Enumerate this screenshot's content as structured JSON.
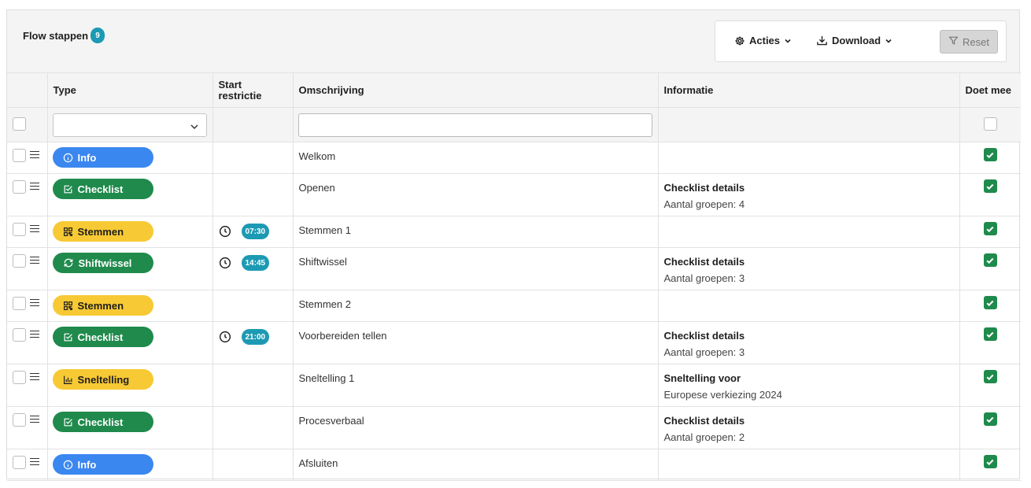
{
  "header": {
    "title": "Flow stappen",
    "count": "9"
  },
  "toolbar": {
    "acties_label": "Acties",
    "download_label": "Download",
    "reset_label": "Reset"
  },
  "columns": {
    "type": "Type",
    "start_line1": "Start",
    "start_line2": "restrictie",
    "omschrijving": "Omschrijving",
    "informatie": "Informatie",
    "doet_mee": "Doet mee"
  },
  "filters": {
    "type_value": "",
    "omschrijving_value": ""
  },
  "colors": {
    "info": "#3b87f0",
    "green": "#1f8a4c",
    "yellow": "#f7c934",
    "teal": "#1c9ab3"
  },
  "rows": [
    {
      "type": "Info",
      "kind": "info",
      "time": "",
      "omschrijving": "Welkom",
      "info_title": "",
      "info_sub": "",
      "doet_mee": true
    },
    {
      "type": "Checklist",
      "kind": "checklist",
      "time": "",
      "omschrijving": "Openen",
      "info_title": "Checklist details",
      "info_sub": "Aantal groepen: 4",
      "doet_mee": true
    },
    {
      "type": "Stemmen",
      "kind": "stemmen",
      "time": "07:30",
      "omschrijving": "Stemmen 1",
      "info_title": "",
      "info_sub": "",
      "doet_mee": true
    },
    {
      "type": "Shiftwissel",
      "kind": "shiftwissel",
      "time": "14:45",
      "omschrijving": "Shiftwissel",
      "info_title": "Checklist details",
      "info_sub": "Aantal groepen: 3",
      "doet_mee": true
    },
    {
      "type": "Stemmen",
      "kind": "stemmen",
      "time": "",
      "omschrijving": "Stemmen 2",
      "info_title": "",
      "info_sub": "",
      "doet_mee": true
    },
    {
      "type": "Checklist",
      "kind": "checklist",
      "time": "21:00",
      "omschrijving": "Voorbereiden tellen",
      "info_title": "Checklist details",
      "info_sub": "Aantal groepen: 3",
      "doet_mee": true
    },
    {
      "type": "Sneltelling",
      "kind": "sneltelling",
      "time": "",
      "omschrijving": "Sneltelling 1",
      "info_title": "Sneltelling voor",
      "info_sub": "Europese verkiezing 2024",
      "doet_mee": true
    },
    {
      "type": "Checklist",
      "kind": "checklist",
      "time": "",
      "omschrijving": "Procesverbaal",
      "info_title": "Checklist details",
      "info_sub": "Aantal groepen: 2",
      "doet_mee": true
    },
    {
      "type": "Info",
      "kind": "info",
      "time": "",
      "omschrijving": "Afsluiten",
      "info_title": "",
      "info_sub": "",
      "doet_mee": true
    }
  ]
}
